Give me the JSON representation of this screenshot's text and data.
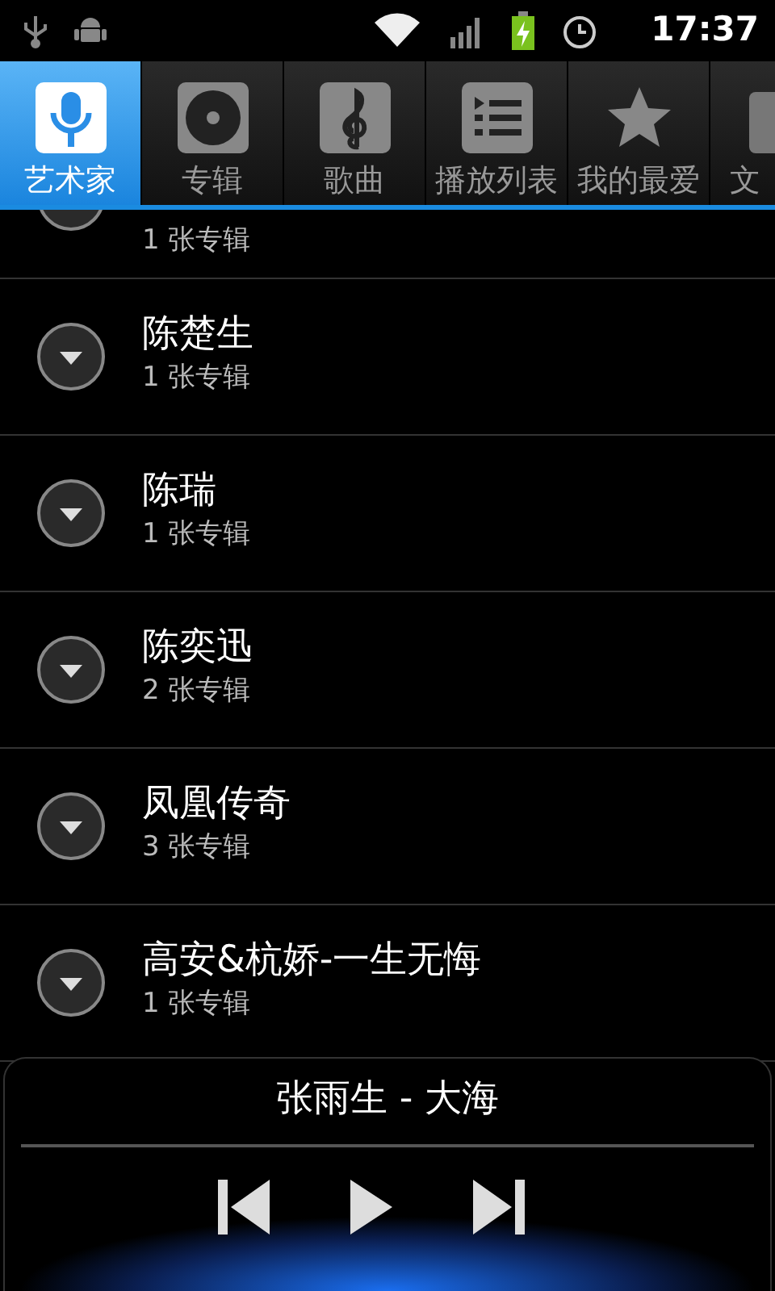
{
  "status_bar": {
    "time": "17:37"
  },
  "tabs": [
    {
      "label": "艺术家",
      "selected": true
    },
    {
      "label": "专辑",
      "selected": false
    },
    {
      "label": "歌曲",
      "selected": false
    },
    {
      "label": "播放列表",
      "selected": false
    },
    {
      "label": "我的最爱",
      "selected": false
    },
    {
      "label": "文",
      "selected": false
    }
  ],
  "artists": [
    {
      "subtitle": "1 张专辑"
    },
    {
      "name": "陈楚生",
      "subtitle": "1 张专辑"
    },
    {
      "name": "陈瑞",
      "subtitle": "1 张专辑"
    },
    {
      "name": "陈奕迅",
      "subtitle": "2 张专辑"
    },
    {
      "name": "凤凰传奇",
      "subtitle": "3 张专辑"
    },
    {
      "name": "高安&杭娇-一生无悔",
      "subtitle": "1 张专辑"
    }
  ],
  "now_playing": {
    "title": "张雨生 - 大海",
    "playing": false
  }
}
